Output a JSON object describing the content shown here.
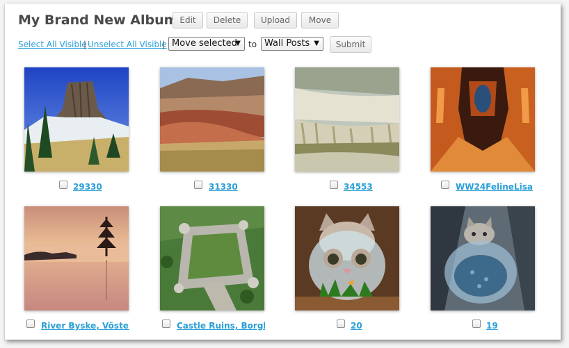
{
  "album": {
    "title": "My Brand New Album",
    "buttons": {
      "edit": "Edit",
      "delete": "Delete",
      "upload": "Upload",
      "move": "Move"
    }
  },
  "toolbar": {
    "select_all": "Select All Visible",
    "separator": "|",
    "unselect_all": "Unselect All Visible",
    "action_select": "Move selected",
    "to_label": "to",
    "destination_select": "Wall Posts",
    "submit": "Submit"
  },
  "photos": [
    {
      "caption": "29330",
      "subject": "butte-rock-tower"
    },
    {
      "caption": "31330",
      "subject": "painted-hills"
    },
    {
      "caption": "34553",
      "subject": "travertine-terraces"
    },
    {
      "caption": "WW24FelineLisa",
      "subject": "red-rock-canyon"
    },
    {
      "caption": "River Byske, Vösterl",
      "subject": "sunset-lake-tree"
    },
    {
      "caption": "Castle Ruins, Borgh",
      "subject": "castle-ruins-aerial"
    },
    {
      "caption": "20",
      "subject": "cat-behind-fishbowl"
    },
    {
      "caption": "19",
      "subject": "cat-in-fishbowl"
    }
  ],
  "colors": {
    "link": "#2a9fd6",
    "title": "#4a4a4a"
  }
}
